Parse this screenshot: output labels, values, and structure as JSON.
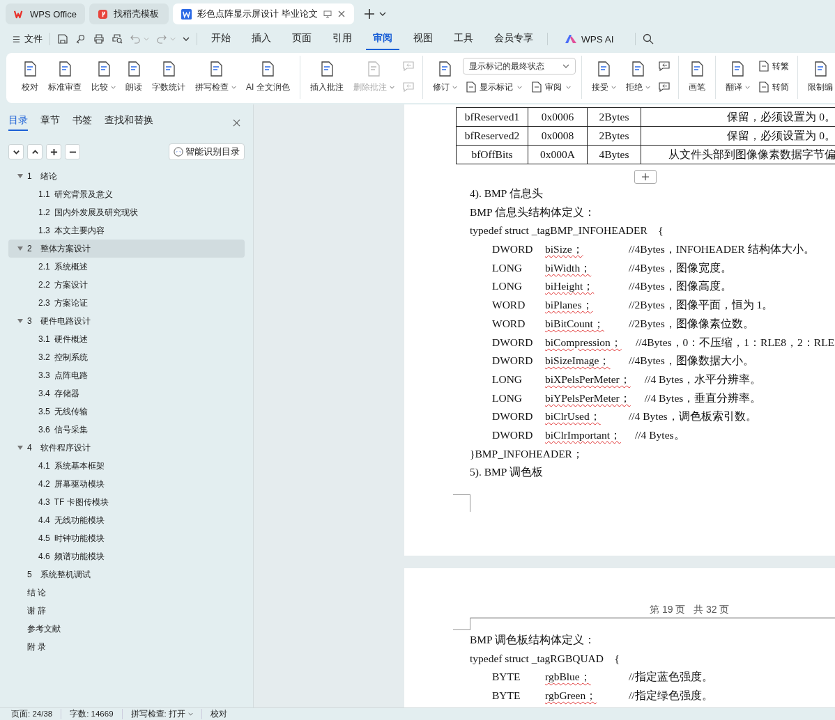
{
  "title_bar": {
    "tabs": [
      {
        "kind": "wps",
        "label": "WPS Office",
        "selected": false
      },
      {
        "kind": "template",
        "label": "找稻壳模板",
        "selected": false
      },
      {
        "kind": "writer",
        "label": "彩色点阵显示屏设计 毕业论文",
        "selected": true
      }
    ]
  },
  "menu_bar": {
    "file": "文件",
    "tabs": [
      {
        "label": "开始",
        "selected": false
      },
      {
        "label": "插入",
        "selected": false
      },
      {
        "label": "页面",
        "selected": false
      },
      {
        "label": "引用",
        "selected": false
      },
      {
        "label": "审阅",
        "selected": true
      },
      {
        "label": "视图",
        "selected": false
      },
      {
        "label": "工具",
        "selected": false
      },
      {
        "label": "会员专享",
        "selected": false
      }
    ],
    "ai": "WPS AI"
  },
  "ribbon": {
    "groups": [
      {
        "items": [
          {
            "kind": "large",
            "label": "校对",
            "dropdown": false,
            "disabled": false
          },
          {
            "kind": "large",
            "label": "标准审查",
            "dropdown": false,
            "disabled": false
          },
          {
            "kind": "large",
            "label": "比较",
            "dropdown": true,
            "disabled": false
          },
          {
            "kind": "large",
            "label": "朗读",
            "dropdown": false,
            "disabled": false
          },
          {
            "kind": "large",
            "label": "字数统计",
            "dropdown": false,
            "disabled": false
          },
          {
            "kind": "large",
            "label": "拼写检查",
            "dropdown": true,
            "disabled": false
          },
          {
            "kind": "large",
            "label": "AI 全文润色",
            "dropdown": false,
            "disabled": false
          }
        ]
      },
      {
        "items": [
          {
            "kind": "large",
            "label": "插入批注",
            "dropdown": false,
            "disabled": false
          },
          {
            "kind": "large",
            "label": "删除批注",
            "dropdown": true,
            "disabled": true
          },
          {
            "kind": "icon",
            "disabled": true
          },
          {
            "kind": "icon",
            "disabled": true
          }
        ]
      },
      {
        "items": [
          {
            "kind": "large",
            "label": "修订",
            "dropdown": true,
            "disabled": false
          },
          {
            "kind": "select",
            "value": "显示标记的最终状态"
          },
          {
            "kind": "small",
            "label": "显示标记",
            "dropdown": true,
            "disabled": false
          },
          {
            "kind": "small",
            "label": "审阅",
            "dropdown": true,
            "disabled": false
          }
        ]
      },
      {
        "items": [
          {
            "kind": "large",
            "label": "接受",
            "dropdown": true,
            "disabled": false
          },
          {
            "kind": "large",
            "label": "拒绝",
            "dropdown": true,
            "disabled": false
          },
          {
            "kind": "icon",
            "disabled": false
          },
          {
            "kind": "icon",
            "disabled": false
          }
        ]
      },
      {
        "items": [
          {
            "kind": "large",
            "label": "画笔",
            "dropdown": false,
            "disabled": false
          }
        ]
      },
      {
        "items": [
          {
            "kind": "large",
            "label": "翻译",
            "dropdown": true,
            "disabled": false
          },
          {
            "kind": "small",
            "label": "转繁",
            "dropdown": false,
            "disabled": false
          },
          {
            "kind": "small",
            "label": "转简",
            "dropdown": false,
            "disabled": false
          }
        ]
      },
      {
        "items": [
          {
            "kind": "large",
            "label": "限制编",
            "dropdown": false,
            "disabled": false
          }
        ]
      }
    ]
  },
  "sidebar": {
    "tabs": [
      {
        "label": "目录",
        "selected": true
      },
      {
        "label": "章节",
        "selected": false
      },
      {
        "label": "书签",
        "selected": false
      },
      {
        "label": "查找和替换",
        "selected": false
      }
    ],
    "smart_button": "智能识别目录",
    "toc": [
      {
        "number": "1",
        "title": "绪论",
        "selected": false,
        "expanded": true,
        "children": [
          {
            "number": "1.1",
            "title": "研究背景及意义",
            "selected": false
          },
          {
            "number": "1.2",
            "title": "国内外发展及研究现状",
            "selected": false
          },
          {
            "number": "1.3",
            "title": "本文主要内容",
            "selected": false
          }
        ]
      },
      {
        "number": "2",
        "title": "整体方案设计",
        "selected": true,
        "expanded": true,
        "children": [
          {
            "number": "2.1",
            "title": "系统概述",
            "selected": false
          },
          {
            "number": "2.2",
            "title": "方案设计",
            "selected": false
          },
          {
            "number": "2.3",
            "title": "方案论证",
            "selected": false
          }
        ]
      },
      {
        "number": "3",
        "title": "硬件电路设计",
        "selected": false,
        "expanded": true,
        "children": [
          {
            "number": "3.1",
            "title": "硬件概述",
            "selected": false
          },
          {
            "number": "3.2",
            "title": "控制系统",
            "selected": false
          },
          {
            "number": "3.3",
            "title": "点阵电路",
            "selected": false
          },
          {
            "number": "3.4",
            "title": "存储器",
            "selected": false
          },
          {
            "number": "3.5",
            "title": "无线传输",
            "selected": false
          },
          {
            "number": "3.6",
            "title": "信号采集",
            "selected": false
          }
        ]
      },
      {
        "number": "4",
        "title": "软件程序设计",
        "selected": false,
        "expanded": true,
        "children": [
          {
            "number": "4.1",
            "title": "系统基本框架",
            "selected": false
          },
          {
            "number": "4.2",
            "title": "屏幕驱动模块",
            "selected": false
          },
          {
            "number": "4.3",
            "title": "TF 卡图传模块",
            "selected": false
          },
          {
            "number": "4.4",
            "title": "无线功能模块",
            "selected": false
          },
          {
            "number": "4.5",
            "title": "时钟功能模块",
            "selected": false
          },
          {
            "number": "4.6",
            "title": "频谱功能模块",
            "selected": false
          }
        ]
      },
      {
        "number": "5",
        "title": "系统整机调试",
        "selected": false
      },
      {
        "title": "结 论",
        "selected": false
      },
      {
        "title": "谢 辞",
        "selected": false
      },
      {
        "title": "参考文献",
        "selected": false
      },
      {
        "title": "附 录",
        "selected": false
      }
    ]
  },
  "document": {
    "pages": [
      {
        "blocks": [
          {
            "kind": "table",
            "rows": [
              [
                "bfReserved1",
                "0x0006",
                "2Bytes",
                "保留，必须设置为 0。"
              ],
              [
                "bfReserved2",
                "0x0008",
                "2Bytes",
                "保留，必须设置为 0。"
              ],
              [
                "bfOffBits",
                "0x000A",
                "4Bytes",
                "从文件头部到图像像素数据字节偏"
              ]
            ]
          },
          {
            "kind": "paragraph",
            "text": "4). BMP 信息头"
          },
          {
            "kind": "paragraph",
            "text": "BMP 信息头结构体定义："
          },
          {
            "kind": "paragraph",
            "text": "typedef struct _tagBMP_INFOHEADER    {"
          },
          {
            "kind": "field",
            "type": "DWORD",
            "name": "biSize；",
            "comment": "//4Bytes，INFOHEADER 结构体大小。"
          },
          {
            "kind": "field",
            "type": "LONG",
            "name": "biWidth；",
            "comment": "//4Bytes，图像宽度。"
          },
          {
            "kind": "field",
            "type": "LONG",
            "name": "biHeight；",
            "comment": "//4Bytes，图像高度。"
          },
          {
            "kind": "field",
            "type": "WORD",
            "name": "biPlanes；",
            "comment": "//2Bytes，图像平面，恒为 1。"
          },
          {
            "kind": "field",
            "type": "WORD",
            "name": "biBitCount；",
            "comment": "//2Bytes，图像像素位数。"
          },
          {
            "kind": "field",
            "type": "DWORD",
            "name": "biCompression；",
            "comment": "//4Bytes，0：不压缩，1：RLE8，2：RLE"
          },
          {
            "kind": "field",
            "type": "DWORD",
            "name": "biSizeImage；",
            "comment": "//4Bytes，图像数据大小。"
          },
          {
            "kind": "field",
            "type": "LONG",
            "name": "biXPelsPerMeter；",
            "comment": "//4 Bytes，水平分辨率。"
          },
          {
            "kind": "field",
            "type": "LONG",
            "name": "biYPelsPerMeter；",
            "comment": "//4 Bytes，垂直分辨率。"
          },
          {
            "kind": "field",
            "type": "DWORD",
            "name": "biClrUsed；",
            "comment": "//4 Bytes，调色板索引数。"
          },
          {
            "kind": "field",
            "type": "DWORD",
            "name": "biClrImportant；",
            "comment": "//4 Bytes。"
          },
          {
            "kind": "paragraph",
            "text": "}BMP_INFOHEADER；"
          },
          {
            "kind": "paragraph",
            "text": "5). BMP 调色板"
          }
        ]
      },
      {
        "header": "第 19 页   共 32 页",
        "blocks": [
          {
            "kind": "paragraph",
            "text": "BMP 调色板结构体定义："
          },
          {
            "kind": "paragraph",
            "text": "typedef struct _tagRGBQUAD    {"
          },
          {
            "kind": "field",
            "type": "BYTE",
            "name": "rgbBlue；",
            "comment": "//指定蓝色强度。"
          },
          {
            "kind": "field",
            "type": "BYTE",
            "name": "rgbGreen；",
            "comment": "//指定绿色强度。"
          }
        ]
      }
    ]
  },
  "status_bar": {
    "items": [
      {
        "text": "页面: 24/38",
        "dropdown": false
      },
      {
        "text": "字数: 14669",
        "dropdown": false
      },
      {
        "text": "拼写检查: 打开",
        "dropdown": true
      },
      {
        "text": "校对",
        "dropdown": false
      }
    ]
  }
}
